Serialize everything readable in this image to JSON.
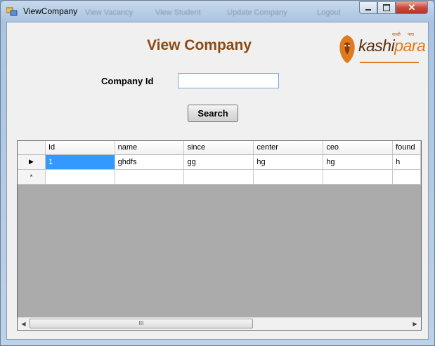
{
  "window": {
    "title": "ViewCompany",
    "background_menu": [
      "View Vacancy",
      "View Student",
      "Update Company",
      "Logout"
    ]
  },
  "form": {
    "heading": "View Company",
    "company_id_label": "Company Id",
    "company_id_value": "",
    "search_label": "Search"
  },
  "logo": {
    "text_dark": "kashi",
    "text_accent": "para"
  },
  "grid": {
    "columns": [
      "Id",
      "name",
      "since",
      "center",
      "ceo",
      "found"
    ],
    "rows": [
      {
        "indicator": "▶",
        "cells": [
          "1",
          "ghdfs",
          "gg",
          "hg",
          "hg",
          "h"
        ]
      },
      {
        "indicator": "*",
        "cells": [
          "",
          "",
          "",
          "",
          "",
          ""
        ]
      }
    ],
    "scroll_thumb_label": "III"
  },
  "colors": {
    "heading": "#8b4a12",
    "selection": "#3399ff",
    "logo_accent": "#e07a1e"
  }
}
